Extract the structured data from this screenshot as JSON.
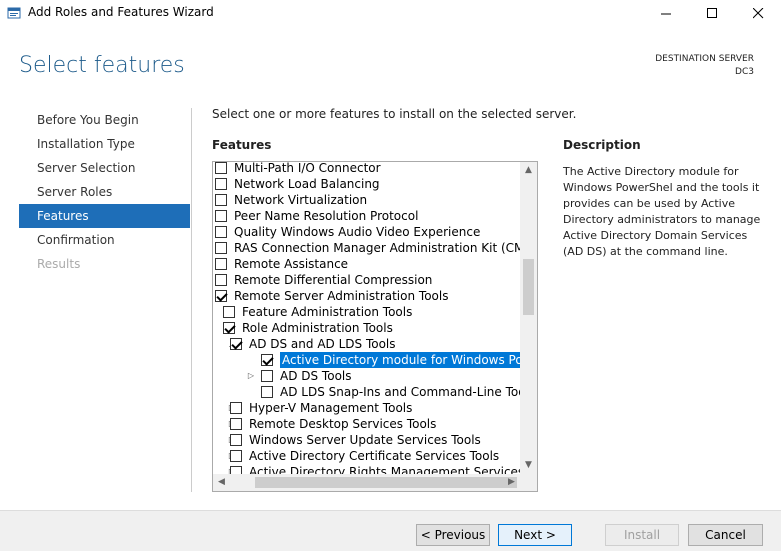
{
  "window": {
    "title": "Add Roles and Features Wizard"
  },
  "header": {
    "page_title": "Select features",
    "destination_label": "DESTINATION SERVER",
    "destination_server": "DC3"
  },
  "nav": {
    "items": [
      {
        "label": "Before You Begin",
        "state": "normal"
      },
      {
        "label": "Installation Type",
        "state": "normal"
      },
      {
        "label": "Server Selection",
        "state": "normal"
      },
      {
        "label": "Server Roles",
        "state": "normal"
      },
      {
        "label": "Features",
        "state": "selected"
      },
      {
        "label": "Confirmation",
        "state": "normal"
      },
      {
        "label": "Results",
        "state": "disabled"
      }
    ]
  },
  "main": {
    "instruction": "Select one or more features to install on the selected server.",
    "features_label": "Features",
    "description_label": "Description",
    "description_text": "The Active Directory module for Windows PowerShel and the tools it provides can be used by Active Directory administrators to manage Active Directory Domain Services (AD DS) at the command line.",
    "tree": [
      {
        "label": "Multi-Path I/O Connector",
        "level": 0,
        "expander": "none",
        "checked": false,
        "selected": false
      },
      {
        "label": "Network Load Balancing",
        "level": 0,
        "expander": "none",
        "checked": false,
        "selected": false
      },
      {
        "label": "Network Virtualization",
        "level": 0,
        "expander": "none",
        "checked": false,
        "selected": false
      },
      {
        "label": "Peer Name Resolution Protocol",
        "level": 0,
        "expander": "none",
        "checked": false,
        "selected": false
      },
      {
        "label": "Quality Windows Audio Video Experience",
        "level": 0,
        "expander": "none",
        "checked": false,
        "selected": false
      },
      {
        "label": "RAS Connection Manager Administration Kit (CMAK)",
        "level": 0,
        "expander": "none",
        "checked": false,
        "selected": false
      },
      {
        "label": "Remote Assistance",
        "level": 0,
        "expander": "none",
        "checked": false,
        "selected": false
      },
      {
        "label": "Remote Differential Compression",
        "level": 0,
        "expander": "none",
        "checked": false,
        "selected": false
      },
      {
        "label": "Remote Server Administration Tools",
        "level": 0,
        "expander": "none",
        "checked": true,
        "selected": false
      },
      {
        "label": "Feature Administration Tools",
        "level": 1,
        "expander": "none",
        "checked": false,
        "selected": false
      },
      {
        "label": "Role Administration Tools",
        "level": 1,
        "expander": "none",
        "checked": true,
        "selected": false
      },
      {
        "label": "AD DS and AD LDS Tools",
        "level": 2,
        "expander": "expanded",
        "checked": true,
        "selected": false
      },
      {
        "label": "Active Directory module for Windows PowerShell",
        "level": 3,
        "expander": "none",
        "checked": true,
        "selected": true
      },
      {
        "label": "AD DS Tools",
        "level": 3,
        "expander": "collapsed",
        "checked": false,
        "selected": false
      },
      {
        "label": "AD LDS Snap-Ins and Command-Line Tools",
        "level": 3,
        "expander": "none",
        "checked": false,
        "selected": false
      },
      {
        "label": "Hyper-V Management Tools",
        "level": 2,
        "expander": "collapsed",
        "checked": false,
        "selected": false
      },
      {
        "label": "Remote Desktop Services Tools",
        "level": 2,
        "expander": "collapsed",
        "checked": false,
        "selected": false
      },
      {
        "label": "Windows Server Update Services Tools",
        "level": 2,
        "expander": "collapsed",
        "checked": false,
        "selected": false
      },
      {
        "label": "Active Directory Certificate Services Tools",
        "level": 2,
        "expander": "collapsed",
        "checked": false,
        "selected": false
      },
      {
        "label": "Active Directory Rights Management Services Tools",
        "level": 2,
        "expander": "collapsed",
        "checked": false,
        "selected": false
      }
    ]
  },
  "footer": {
    "previous_label": "< Previous",
    "next_label": "Next >",
    "install_label": "Install",
    "cancel_label": "Cancel"
  },
  "colors": {
    "title_blue": "#1c5a8a",
    "nav_selected": "#1e6eb8",
    "tree_selected": "#0078d7"
  }
}
